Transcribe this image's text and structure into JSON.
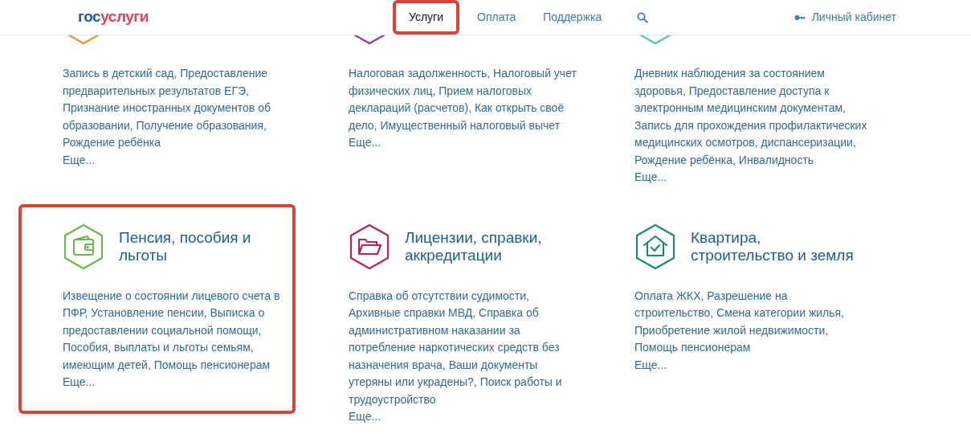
{
  "header": {
    "logo": {
      "part_1": "гос",
      "part_2": "услуги"
    },
    "nav": [
      {
        "label": "Услуги",
        "selected": true
      },
      {
        "label": "Оплата",
        "selected": false
      },
      {
        "label": "Поддержка",
        "selected": false
      }
    ],
    "account": "Личный кабинет"
  },
  "rows": [
    [
      {
        "kind": "cut",
        "color": "#e8923a",
        "description": "Запись в детский сад, Предоставление предварительных результатов ЕГЭ, Признание иностранных документов об образовании, Получение образования, Рождение ребёнка",
        "more": "Еще...",
        "highlighted": false
      },
      {
        "kind": "cut",
        "color": "#8e3a96",
        "description": "Налоговая задолженность, Налоговый учет физических лиц, Прием налоговых деклараций (расчетов), Как открыть своё дело, Имущественный налоговый вычет",
        "more": "Еще...",
        "highlighted": false
      },
      {
        "kind": "cut",
        "color": "#5bbfb5",
        "description": "Дневник наблюдения за состоянием здоровья, Предоставление доступа к электронным медицинским документам, Запись для прохождения профилактических медицинских осмотров, диспансеризации, Рождение ребёнка, Инвалидность",
        "more": "Еще...",
        "highlighted": false
      }
    ],
    [
      {
        "kind": "wallet",
        "color": "#6db552",
        "title": "Пенсия, пособия и льготы",
        "description": "Извещение о состоянии лицевого счета в ПФР, Установление пенсии, Выписка о предоставлении социальной помощи, Пособия, выплаты и льготы семьям, имеющим детей, Помощь пенсионерам",
        "more": "Еще...",
        "highlighted": true
      },
      {
        "kind": "folder",
        "color": "#b5245b",
        "title": "Лицензии, справки, аккредитации",
        "description": "Справка об отсутствии судимости, Архивные справки МВД, Справка об административном наказании за потребление наркотических средств без назначения врача, Ваши документы утеряны или украдены?, Поиск работы и трудоустройство",
        "more": "Еще...",
        "highlighted": false
      },
      {
        "kind": "house",
        "color": "#1f8a63",
        "title": "Квартира, строительство и земля",
        "description": "Оплата ЖКХ, Разрешение на строительство, Смена категории жилья, Приобретение жилой недвижимости, Помощь пенсионерам",
        "more": "Еще...",
        "highlighted": false
      }
    ]
  ]
}
